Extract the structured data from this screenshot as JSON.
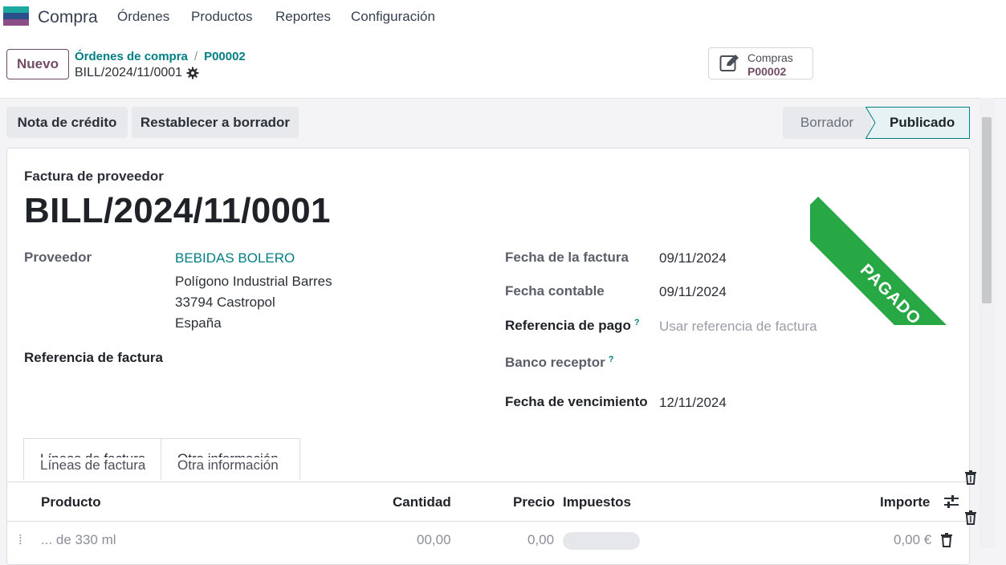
{
  "app": {
    "name": "Compra",
    "menu": [
      "Órdenes",
      "Productos",
      "Reportes",
      "Configuración"
    ]
  },
  "control": {
    "new_button": "Nuevo",
    "breadcrumb": [
      "Órdenes de compra",
      "P00002"
    ],
    "breadcrumb_sep": "/",
    "record_name": "BILL/2024/11/0001",
    "smart_button": {
      "label": "Compras",
      "value": "P00002",
      "icon": "edit-document-icon"
    }
  },
  "actions": {
    "credit_note": "Nota de crédito",
    "reset_draft": "Restablecer a borrador"
  },
  "status": {
    "steps": [
      "Borrador",
      "Publicado"
    ],
    "active": "Publicado"
  },
  "sheet": {
    "doc_type": "Factura de proveedor",
    "title": "BILL/2024/11/0001",
    "ribbon": "PAGADO",
    "left": {
      "vendor_label": "Proveedor",
      "vendor_name": "BEBIDAS BOLERO",
      "vendor_addr1": "Polígono Industrial Barres",
      "vendor_addr2": "33794 Castropol",
      "vendor_addr3": "España",
      "bill_ref_label": "Referencia de factura"
    },
    "right": {
      "invoice_date_label": "Fecha de la factura",
      "invoice_date": "09/11/2024",
      "acct_date_label": "Fecha contable",
      "acct_date": "09/11/2024",
      "payment_ref_label": "Referencia de pago",
      "payment_ref_placeholder": "Usar referencia de factura",
      "bank_label": "Banco receptor",
      "due_label": "Fecha de vencimiento",
      "due_date": "12/11/2024",
      "help_mark": "?"
    },
    "tabs": [
      "Líneas de factura",
      "Otra información"
    ],
    "table": {
      "headers": [
        "Producto",
        "Cantidad",
        "Precio",
        "Impuestos",
        "Importe"
      ],
      "partial_row": {
        "product": "... de 330 ml",
        "qty": "00,00",
        "price": "0,00",
        "amount": "0,00 €"
      }
    }
  },
  "colors": {
    "brand": "#714B67",
    "link": "#017e84",
    "ribbon": "#28a745"
  }
}
